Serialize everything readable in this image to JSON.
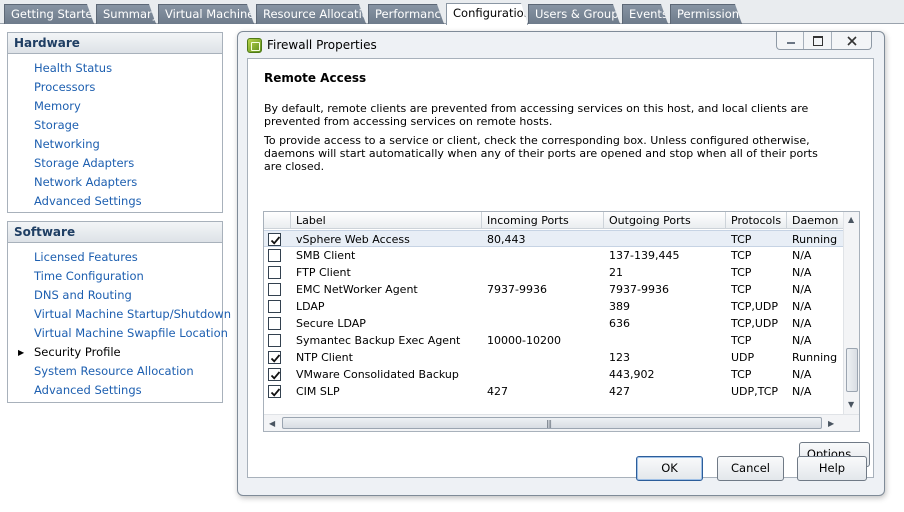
{
  "top_tabs": [
    {
      "label": "Getting Started",
      "active": false
    },
    {
      "label": "Summary",
      "active": false
    },
    {
      "label": "Virtual Machines",
      "active": false
    },
    {
      "label": "Resource Allocation",
      "active": false
    },
    {
      "label": "Performance",
      "active": false
    },
    {
      "label": "Configuration",
      "active": true
    },
    {
      "label": "Users & Groups",
      "active": false
    },
    {
      "label": "Events",
      "active": false
    },
    {
      "label": "Permissions",
      "active": false
    }
  ],
  "hardware": {
    "title": "Hardware",
    "items": [
      "Health Status",
      "Processors",
      "Memory",
      "Storage",
      "Networking",
      "Storage Adapters",
      "Network Adapters",
      "Advanced Settings"
    ]
  },
  "software": {
    "title": "Software",
    "items": [
      "Licensed Features",
      "Time Configuration",
      "DNS and Routing",
      "Virtual Machine Startup/Shutdown",
      "Virtual Machine Swapfile Location",
      "Security Profile",
      "System Resource Allocation",
      "Advanced Settings"
    ],
    "current": "Security Profile"
  },
  "dialog": {
    "title": "Firewall Properties",
    "section_title": "Remote Access",
    "paragraph1": "By default, remote clients are prevented from accessing services on this host, and local clients are prevented from accessing services on remote hosts.",
    "paragraph2": "To provide access to a service or client, check the corresponding box. Unless configured otherwise, daemons will start automatically when any of their ports are opened and stop when all of their ports are closed.",
    "columns": [
      "Label",
      "Incoming Ports",
      "Outgoing Ports",
      "Protocols",
      "Daemon"
    ],
    "rows": [
      {
        "checked": true,
        "label": "vSphere Web Access",
        "incoming": "80,443",
        "outgoing": "",
        "protocols": "TCP",
        "daemon": "Running"
      },
      {
        "checked": false,
        "label": "SMB Client",
        "incoming": "",
        "outgoing": "137-139,445",
        "protocols": "TCP",
        "daemon": "N/A"
      },
      {
        "checked": false,
        "label": "FTP Client",
        "incoming": "",
        "outgoing": "21",
        "protocols": "TCP",
        "daemon": "N/A"
      },
      {
        "checked": false,
        "label": "EMC NetWorker Agent",
        "incoming": "7937-9936",
        "outgoing": "7937-9936",
        "protocols": "TCP",
        "daemon": "N/A"
      },
      {
        "checked": false,
        "label": "LDAP",
        "incoming": "",
        "outgoing": "389",
        "protocols": "TCP,UDP",
        "daemon": "N/A"
      },
      {
        "checked": false,
        "label": "Secure LDAP",
        "incoming": "",
        "outgoing": "636",
        "protocols": "TCP,UDP",
        "daemon": "N/A"
      },
      {
        "checked": false,
        "label": "Symantec Backup Exec Agent",
        "incoming": "10000-10200",
        "outgoing": "",
        "protocols": "TCP",
        "daemon": "N/A"
      },
      {
        "checked": true,
        "label": "NTP Client",
        "incoming": "",
        "outgoing": "123",
        "protocols": "UDP",
        "daemon": "Running"
      },
      {
        "checked": true,
        "label": "VMware Consolidated Backup",
        "incoming": "",
        "outgoing": "443,902",
        "protocols": "TCP",
        "daemon": "N/A"
      },
      {
        "checked": true,
        "label": "CIM SLP",
        "incoming": "427",
        "outgoing": "427",
        "protocols": "UDP,TCP",
        "daemon": "N/A"
      }
    ],
    "options_label": "Options...",
    "ok_label": "OK",
    "cancel_label": "Cancel",
    "help_label": "Help"
  },
  "colors": {
    "link": "#1d5fb0",
    "header_text": "#1f3e63",
    "tab_bg": "#7a8797"
  }
}
